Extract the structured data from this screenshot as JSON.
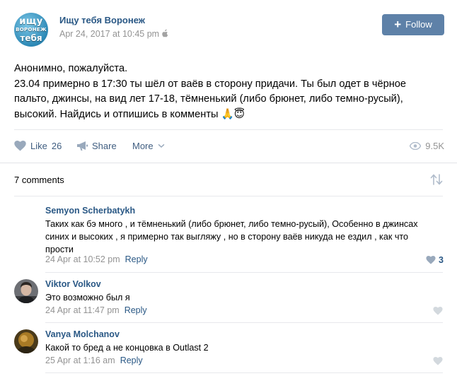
{
  "post": {
    "group_name": "Ищу тебя Воронеж",
    "avatar_text": {
      "line1": "ищу",
      "line2": "ВОРОНЕЖ",
      "line3": "тебя"
    },
    "date": "Apr 24, 2017 at 10:45 pm",
    "follow_label": "Follow",
    "text_lines": [
      "Анонимно, пожалуйста.",
      "23.04 примерно в 17:30 ты шёл от ваёв в сторону придачи. Ты был одет в чёрное",
      "пальто, джинсы, на вид лет 17-18, тёмненький (либо брюнет, либо темно-русый),",
      "высокий. Найдись и отпишись в комменты"
    ],
    "emojis": [
      "🙏",
      "😇"
    ],
    "actions": {
      "like_label": "Like",
      "like_count": "26",
      "share_label": "Share",
      "more_label": "More",
      "views": "9.5K"
    }
  },
  "comments_header": "7 comments",
  "comments": [
    {
      "author": "Semyon Scherbatykh",
      "text_lines": [
        "Таких как бэ много , и тёмненький (либо брюнет, либо темно-русый), Особенно в джинсах",
        "синих и высоких , я примерно так выгляжу , но в сторону ваёв никуда не ездил , как что",
        "прости"
      ],
      "date": "24 Apr at 10:52 pm",
      "reply_label": "Reply",
      "likes": "3"
    },
    {
      "author": "Viktor Volkov",
      "text_lines": [
        "Это возможно был я"
      ],
      "date": "24 Apr at 11:47 pm",
      "reply_label": "Reply",
      "likes": ""
    },
    {
      "author": "Vanya Molchanov",
      "text_lines": [
        "Какой то бред а не концовка в Outlast 2"
      ],
      "date": "25 Apr at 1:16 am",
      "reply_label": "Reply",
      "likes": ""
    }
  ],
  "colors": {
    "link": "#2a5885",
    "follow_button": "#5e81a8",
    "muted": "#939393",
    "icon": "#99a9bc",
    "like_active": "#5e81a8"
  }
}
